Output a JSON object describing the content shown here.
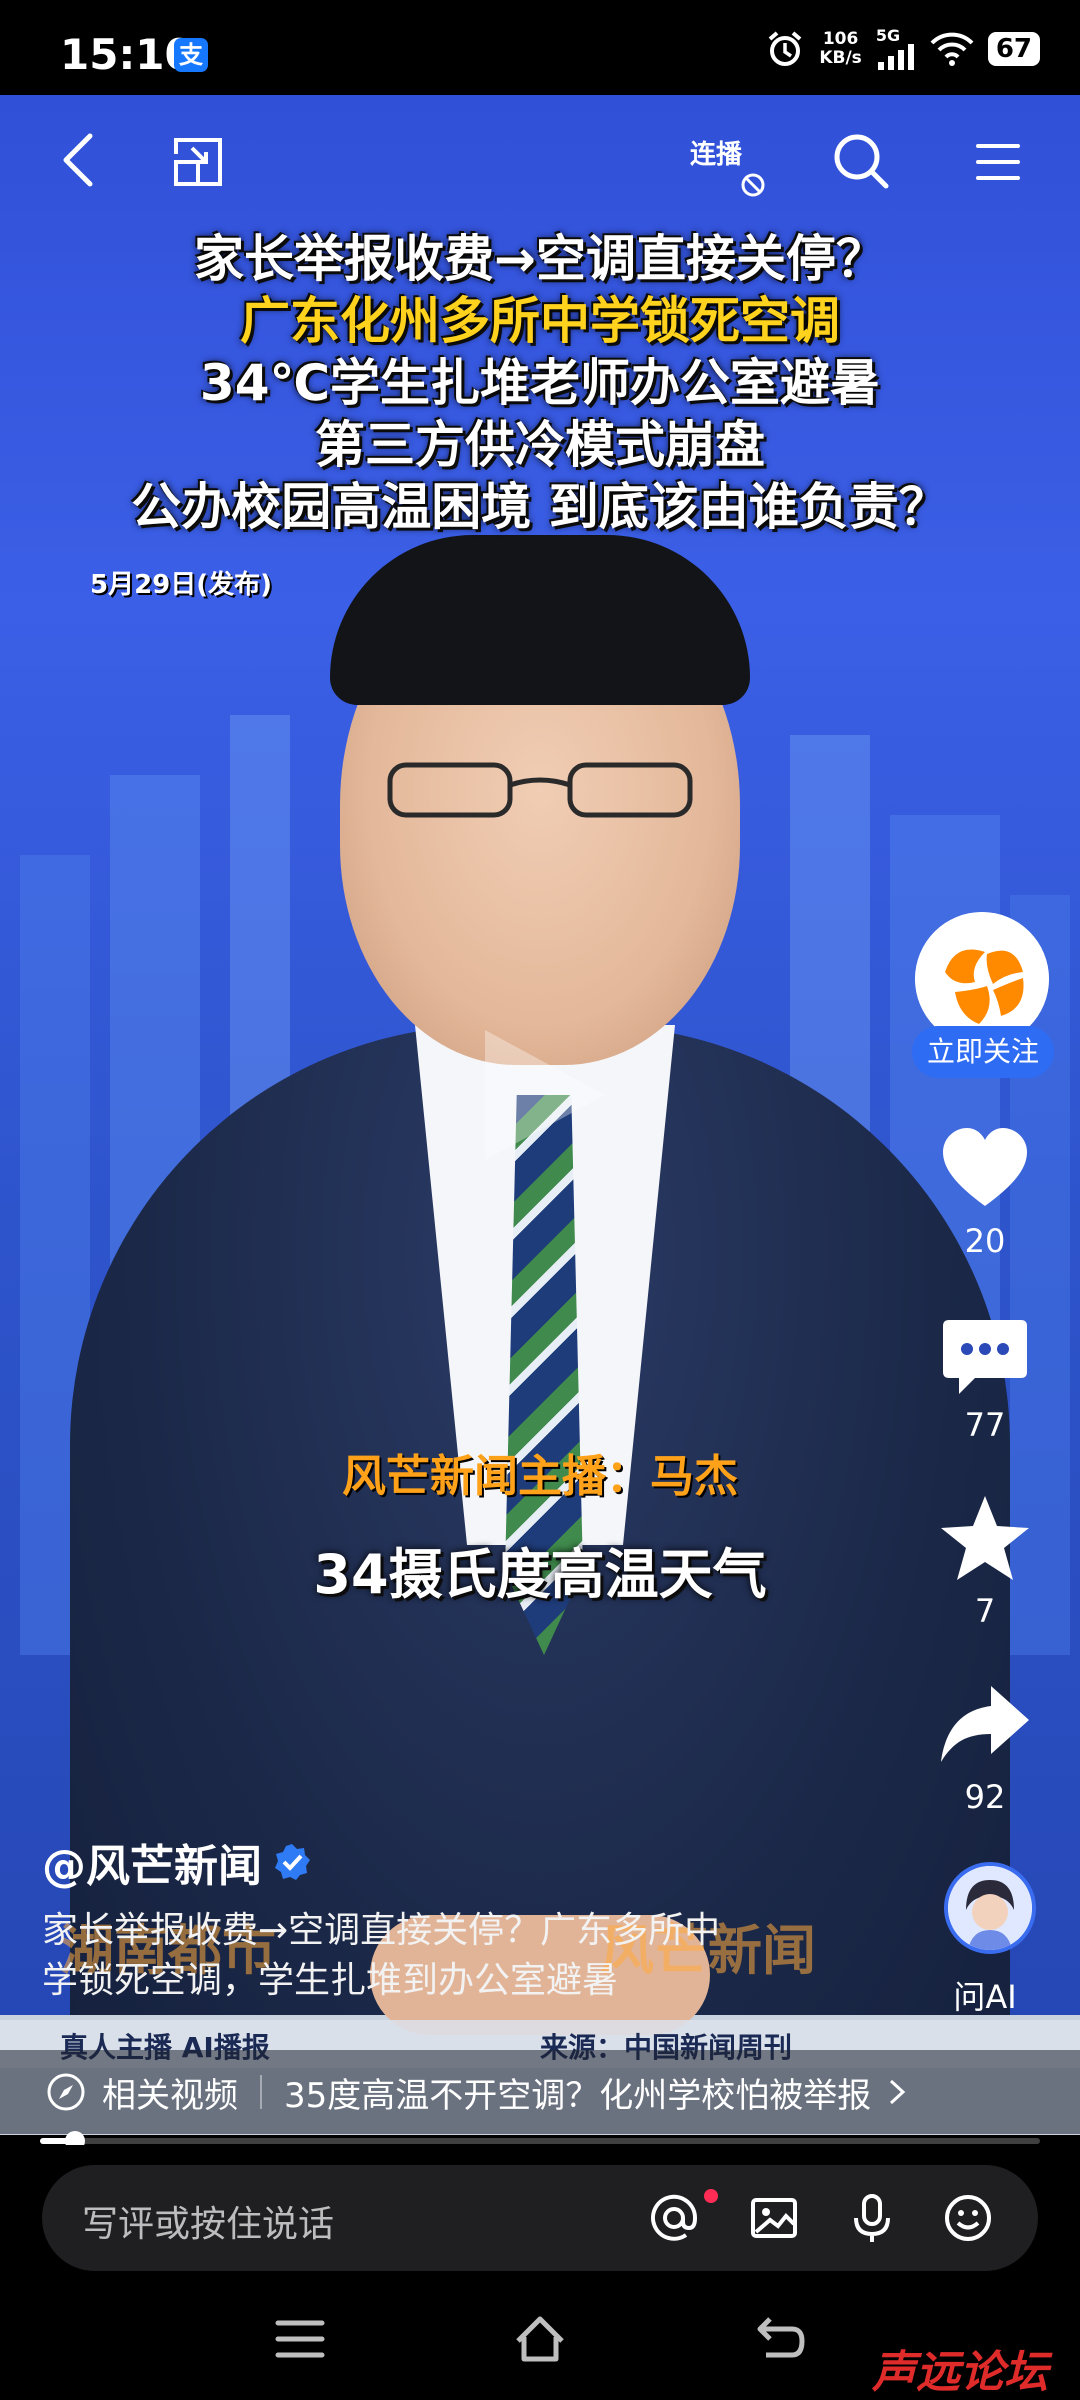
{
  "status_bar": {
    "time": "15:10",
    "pay_glyph": "支",
    "net_speed_value": "106",
    "net_speed_unit": "KB/s",
    "signal": "5G",
    "battery": "67"
  },
  "top_bar": {
    "lianbo_label": "连播",
    "icons": [
      "back-icon",
      "fullscreen-exit-icon",
      "search-icon",
      "menu-icon"
    ]
  },
  "video": {
    "headline": [
      "家长举报收费→空调直接关停？",
      "广东化州多所中学锁死空调",
      "34℃学生扎堆老师办公室避暑",
      "第三方供冷模式崩盘",
      "公办校园高温困境 到底该由谁负责？"
    ],
    "date": "5月29日(发布)",
    "subtitle_anchor": "风芒新闻主播：马杰",
    "subtitle_text": "34摄氏度高温天气",
    "watermark_left": "湖南都市",
    "watermark_right": "风芒新闻",
    "lower_third_left": "真人主播 AI播报",
    "lower_third_right": "来源：中国新闻周刊"
  },
  "right_rail": {
    "follow_label": "立即关注",
    "likes": "20",
    "comments": "77",
    "favorites": "7",
    "shares": "92",
    "ai_label": "问AI"
  },
  "post": {
    "author": "@风芒新闻",
    "description_line1": "家长举报收费→空调直接关停？广东多所中",
    "description_line2": "学锁死空调，学生扎堆到办公室避暑"
  },
  "related": {
    "label": "相关视频",
    "title": "35度高温不开空调？化州学校怕被举报"
  },
  "progress": {
    "fraction": 0.035
  },
  "comment_bar": {
    "placeholder": "写评或按住说话"
  },
  "watermark_site": "声远论坛",
  "colors": {
    "accent_blue": "#2f6cf4",
    "headline_yellow": "#ffd21e",
    "subtitle_orange": "#ffa21a",
    "notify_red": "#ff2d55"
  }
}
